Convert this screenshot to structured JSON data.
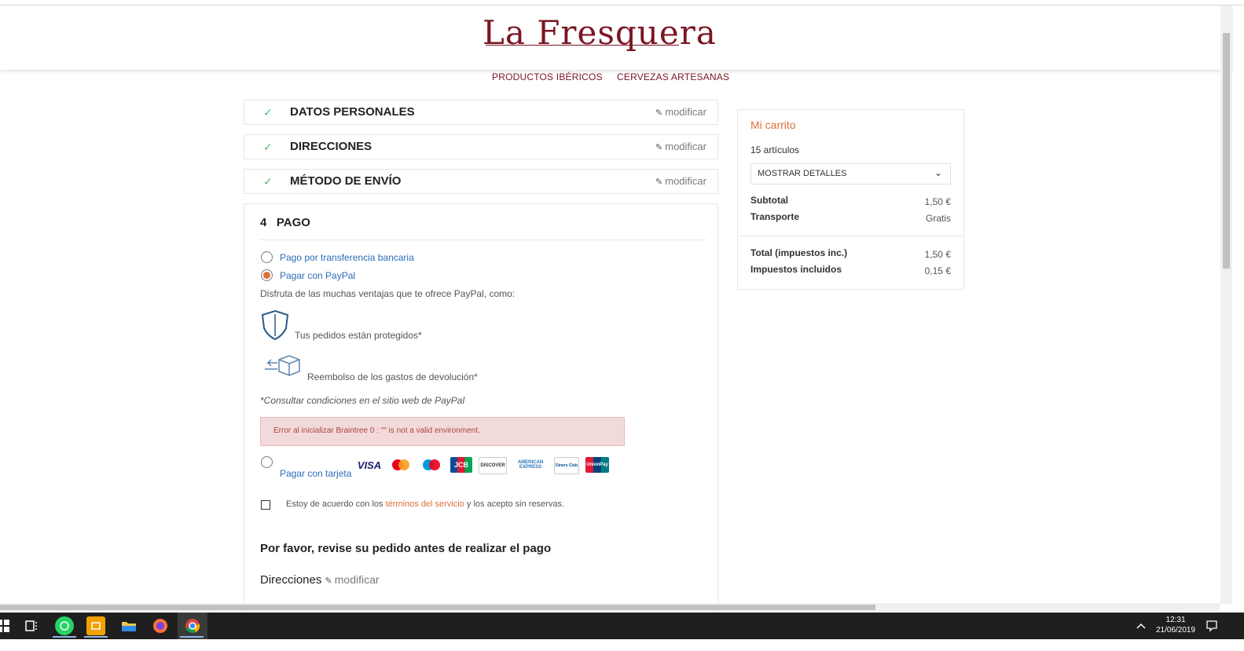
{
  "brand": {
    "logo": "La Fresquera"
  },
  "nav": {
    "items": [
      "PRODUCTOS IBÉRICOS",
      "CERVEZAS ARTESANAS"
    ]
  },
  "steps": [
    {
      "check": "✓",
      "title": "DATOS PERSONALES",
      "modify": "modificar"
    },
    {
      "check": "✓",
      "title": "DIRECCIONES",
      "modify": "modificar"
    },
    {
      "check": "✓",
      "title": "MÉTODO DE ENVÍO",
      "modify": "modificar"
    }
  ],
  "payment": {
    "title": "4   PAGO",
    "option_transfer": "Pago por transferencia bancaria",
    "option_paypal": "Pagar con PayPal",
    "paypal_intro": "Disfruta de las muchas ventajas que te ofrece PayPal, como:",
    "benefit_protected": "Tus pedidos están protegidos*",
    "benefit_refund": "Reembolso de los gastos de devolución*",
    "note": "*Consultar condiciones en el sitio web de PayPal",
    "error": "Error al inicializar Braintree 0 : \"\" is not a valid environment.",
    "option_card": "Pagar con tarjeta",
    "cards": [
      "VISA",
      "MC",
      "Maestro",
      "JCB",
      "DISCOVER",
      "AMERICAN EXPRESS",
      "Diners Club",
      "UnionPay"
    ],
    "terms_pre": "Estoy de acuerdo con los ",
    "terms_link": "términos del servicio",
    "terms_post": " y los acepto sin reservas.",
    "review": "Por favor, revise su pedido antes de realizar el pago",
    "review_addresses": "Direcciones",
    "review_modify": "modificar"
  },
  "cart": {
    "title": "Mi carrito",
    "count": "15 artículos",
    "details_label": "MOSTRAR DETALLES",
    "subtotal_label": "Subtotal",
    "subtotal_value": "1,50 €",
    "shipping_label": "Transporte",
    "shipping_value": "Gratis",
    "total_label": "Total (impuestos inc.)",
    "total_value": "1,50 €",
    "taxes_label": "Impuestos incluidos",
    "taxes_value": "0,15 €"
  },
  "taskbar": {
    "time": "12:31",
    "date": "21/06/2019"
  },
  "colors": {
    "brand": "#7a1522",
    "accent": "#e0703a",
    "link": "#2b6bb7",
    "check": "#4cbb6c",
    "error_bg": "#f3dada"
  }
}
